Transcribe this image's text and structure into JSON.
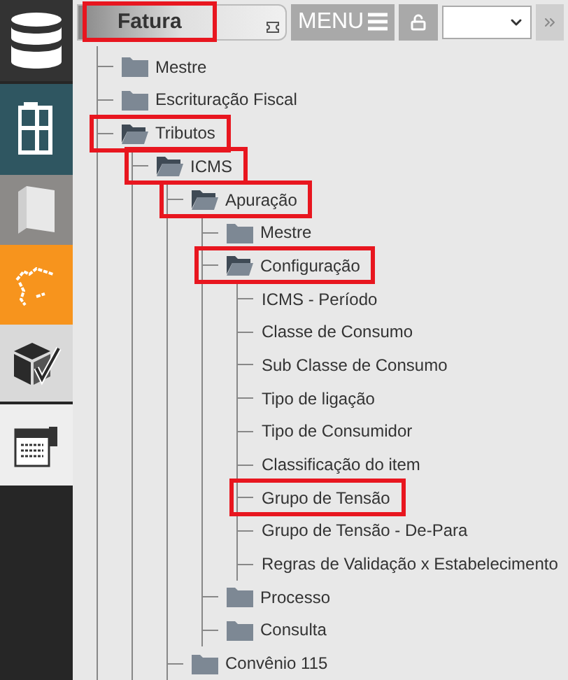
{
  "header": {
    "tab": {
      "label": "Fatura",
      "highlighted": true
    },
    "menu_button": "MENU"
  },
  "tree": [
    {
      "kind": "folder",
      "label": "Mestre",
      "expanded": false,
      "highlighted": false
    },
    {
      "kind": "folder",
      "label": "Escrituração Fiscal",
      "expanded": false,
      "highlighted": false
    },
    {
      "kind": "folder",
      "label": "Tributos",
      "expanded": true,
      "highlighted": true,
      "children": [
        {
          "kind": "folder",
          "label": "ICMS",
          "expanded": true,
          "highlighted": true,
          "children": [
            {
              "kind": "folder",
              "label": "Apuração",
              "expanded": true,
              "highlighted": true,
              "children": [
                {
                  "kind": "folder",
                  "label": "Mestre",
                  "expanded": false,
                  "highlighted": false
                },
                {
                  "kind": "folder",
                  "label": "Configuração",
                  "expanded": true,
                  "highlighted": true,
                  "children": [
                    {
                      "kind": "leaf",
                      "label": "ICMS - Período",
                      "highlighted": false
                    },
                    {
                      "kind": "leaf",
                      "label": "Classe de Consumo",
                      "highlighted": false
                    },
                    {
                      "kind": "leaf",
                      "label": "Sub Classe de Consumo",
                      "highlighted": false
                    },
                    {
                      "kind": "leaf",
                      "label": "Tipo de ligação",
                      "highlighted": false
                    },
                    {
                      "kind": "leaf",
                      "label": "Tipo de Consumidor",
                      "highlighted": false
                    },
                    {
                      "kind": "leaf",
                      "label": "Classificação do item",
                      "highlighted": false
                    },
                    {
                      "kind": "leaf",
                      "label": "Grupo de Tensão",
                      "highlighted": true
                    },
                    {
                      "kind": "leaf",
                      "label": "Grupo de Tensão - De-Para",
                      "highlighted": false
                    },
                    {
                      "kind": "leaf",
                      "label": "Regras de Validação x Estabelecimento",
                      "highlighted": false
                    }
                  ]
                },
                {
                  "kind": "folder",
                  "label": "Processo",
                  "expanded": false,
                  "highlighted": false
                },
                {
                  "kind": "folder",
                  "label": "Consulta",
                  "expanded": false,
                  "highlighted": false
                }
              ]
            },
            {
              "kind": "folder",
              "label": "Convênio 115",
              "expanded": false,
              "highlighted": false
            }
          ]
        }
      ]
    }
  ]
}
